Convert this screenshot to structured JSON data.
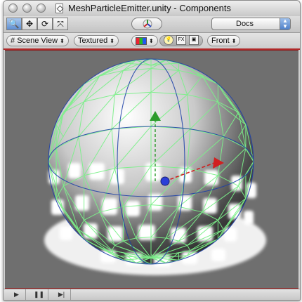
{
  "window": {
    "title": "MeshParticleEmitter.unity - Components"
  },
  "toolbar": {
    "tools": [
      {
        "name": "view-tool",
        "glyph": "🔍",
        "active": true
      },
      {
        "name": "move-tool",
        "glyph": "✥",
        "active": false
      },
      {
        "name": "rotate-tool",
        "glyph": "⟳",
        "active": false
      },
      {
        "name": "scale-tool",
        "glyph": "⤧",
        "active": false
      }
    ],
    "layout_select": "Docs"
  },
  "scene_options": {
    "view_mode": "Scene View",
    "draw_mode": "Textured",
    "lighting_icon": "lightbulb-icon",
    "fx_label": "FX",
    "camera_view": "Front"
  },
  "playbar": {
    "play_glyph": "▶",
    "pause_glyph": "❚❚",
    "step_glyph": "▶|"
  },
  "colors": {
    "accent_red": "#b02828",
    "wire_green": "#7cf08a",
    "axis_blue": "#1b3fa8",
    "viewport_bg": "#6f6f6f"
  }
}
